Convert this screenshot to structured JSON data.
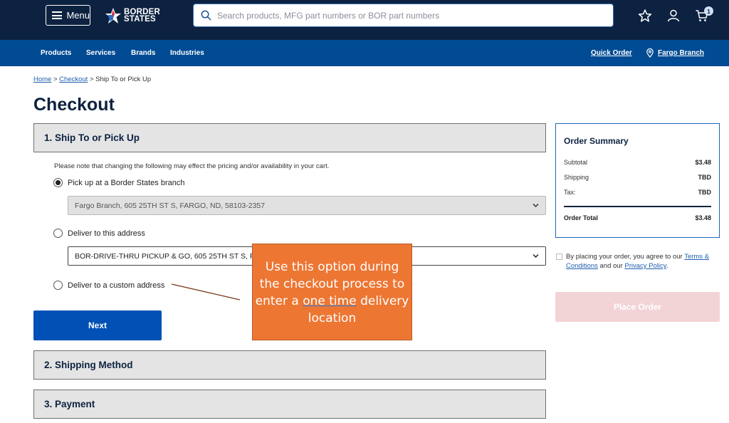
{
  "header": {
    "menu_label": "Menu",
    "logo_line1": "BORDER",
    "logo_line2": "STATES",
    "search_placeholder": "Search products, MFG part numbers or BOR part numbers",
    "cart_count": "1"
  },
  "nav": {
    "items": [
      "Products",
      "Services",
      "Brands",
      "Industries"
    ],
    "quick_order": "Quick Order",
    "branch": "Fargo Branch"
  },
  "breadcrumb": {
    "home": "Home",
    "sep1": " > ",
    "checkout": "Checkout",
    "sep2": " > ",
    "current": "Ship To or Pick Up"
  },
  "page_title": "Checkout",
  "steps": {
    "step1": "1. Ship To or Pick Up",
    "step2": "2. Shipping Method",
    "step3": "3. Payment"
  },
  "ship_to": {
    "note": "Please note that changing the following may effect the pricing and/or availability in your cart.",
    "option_pickup": "Pick up at a Border States branch",
    "pickup_value": "Fargo Branch, 605 25TH ST S, FARGO, ND, 58103-2357",
    "option_deliver": "Deliver to this address",
    "deliver_value": "BOR-DRIVE-THRU PICKUP & GO, 605 25TH ST S, FA",
    "option_custom": "Deliver to a custom address",
    "next_label": "Next"
  },
  "callout": {
    "line1": "Use this option during",
    "line2": "the checkout process to",
    "line3_pre": "enter a ",
    "line3_ul": "one time",
    "line3_post": " delivery",
    "line4": "location"
  },
  "summary": {
    "title": "Order Summary",
    "subtotal_label": "Subtotal",
    "subtotal_value": "$3.48",
    "shipping_label": "Shipping",
    "shipping_value": "TBD",
    "tax_label": "Tax:",
    "tax_value": "TBD",
    "total_label": "Order Total",
    "total_value": "$3.48"
  },
  "agree": {
    "pre": "By placing your order, you agree to our ",
    "terms": "Terms & Conditions",
    "mid": " and our ",
    "privacy": "Privacy Policy",
    "post": "."
  },
  "place_order_label": "Place Order",
  "colors": {
    "header_bg": "#0d2240",
    "nav_bg": "#004b93",
    "primary_button": "#0050b5",
    "disabled_button": "#f2d3d6",
    "callout_bg": "#ed7633"
  }
}
